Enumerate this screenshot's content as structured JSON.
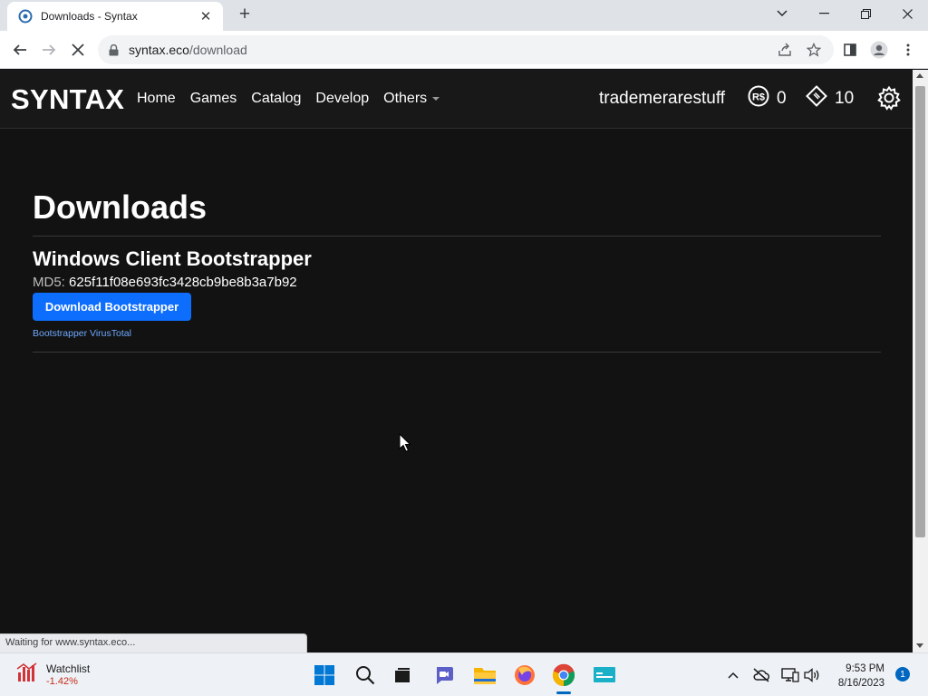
{
  "browser": {
    "tab_title": "Downloads - Syntax",
    "url_host": "syntax.eco",
    "url_path": "/download",
    "status_text": "Waiting for www.syntax.eco..."
  },
  "site": {
    "brand": "SYNTAX",
    "nav": [
      "Home",
      "Games",
      "Catalog",
      "Develop",
      "Others"
    ],
    "username": "trademerarestuff",
    "robux": "0",
    "tickets": "10"
  },
  "page": {
    "title": "Downloads",
    "section_title": "Windows Client Bootstrapper",
    "md5_label": "MD5:",
    "md5_value": "625f11f08e693fc3428cb9be8b3a7b92",
    "download_button": "Download Bootstrapper",
    "virustotal_link": "Bootstrapper VirusTotal"
  },
  "taskbar": {
    "widget_name": "Watchlist",
    "widget_value": "-1.42%",
    "time": "9:53 PM",
    "date": "8/16/2023",
    "notifications": "1"
  },
  "colors": {
    "accent": "#0d6efd",
    "link": "#6ea8fe",
    "background": "#121212",
    "navbar": "#181818"
  }
}
